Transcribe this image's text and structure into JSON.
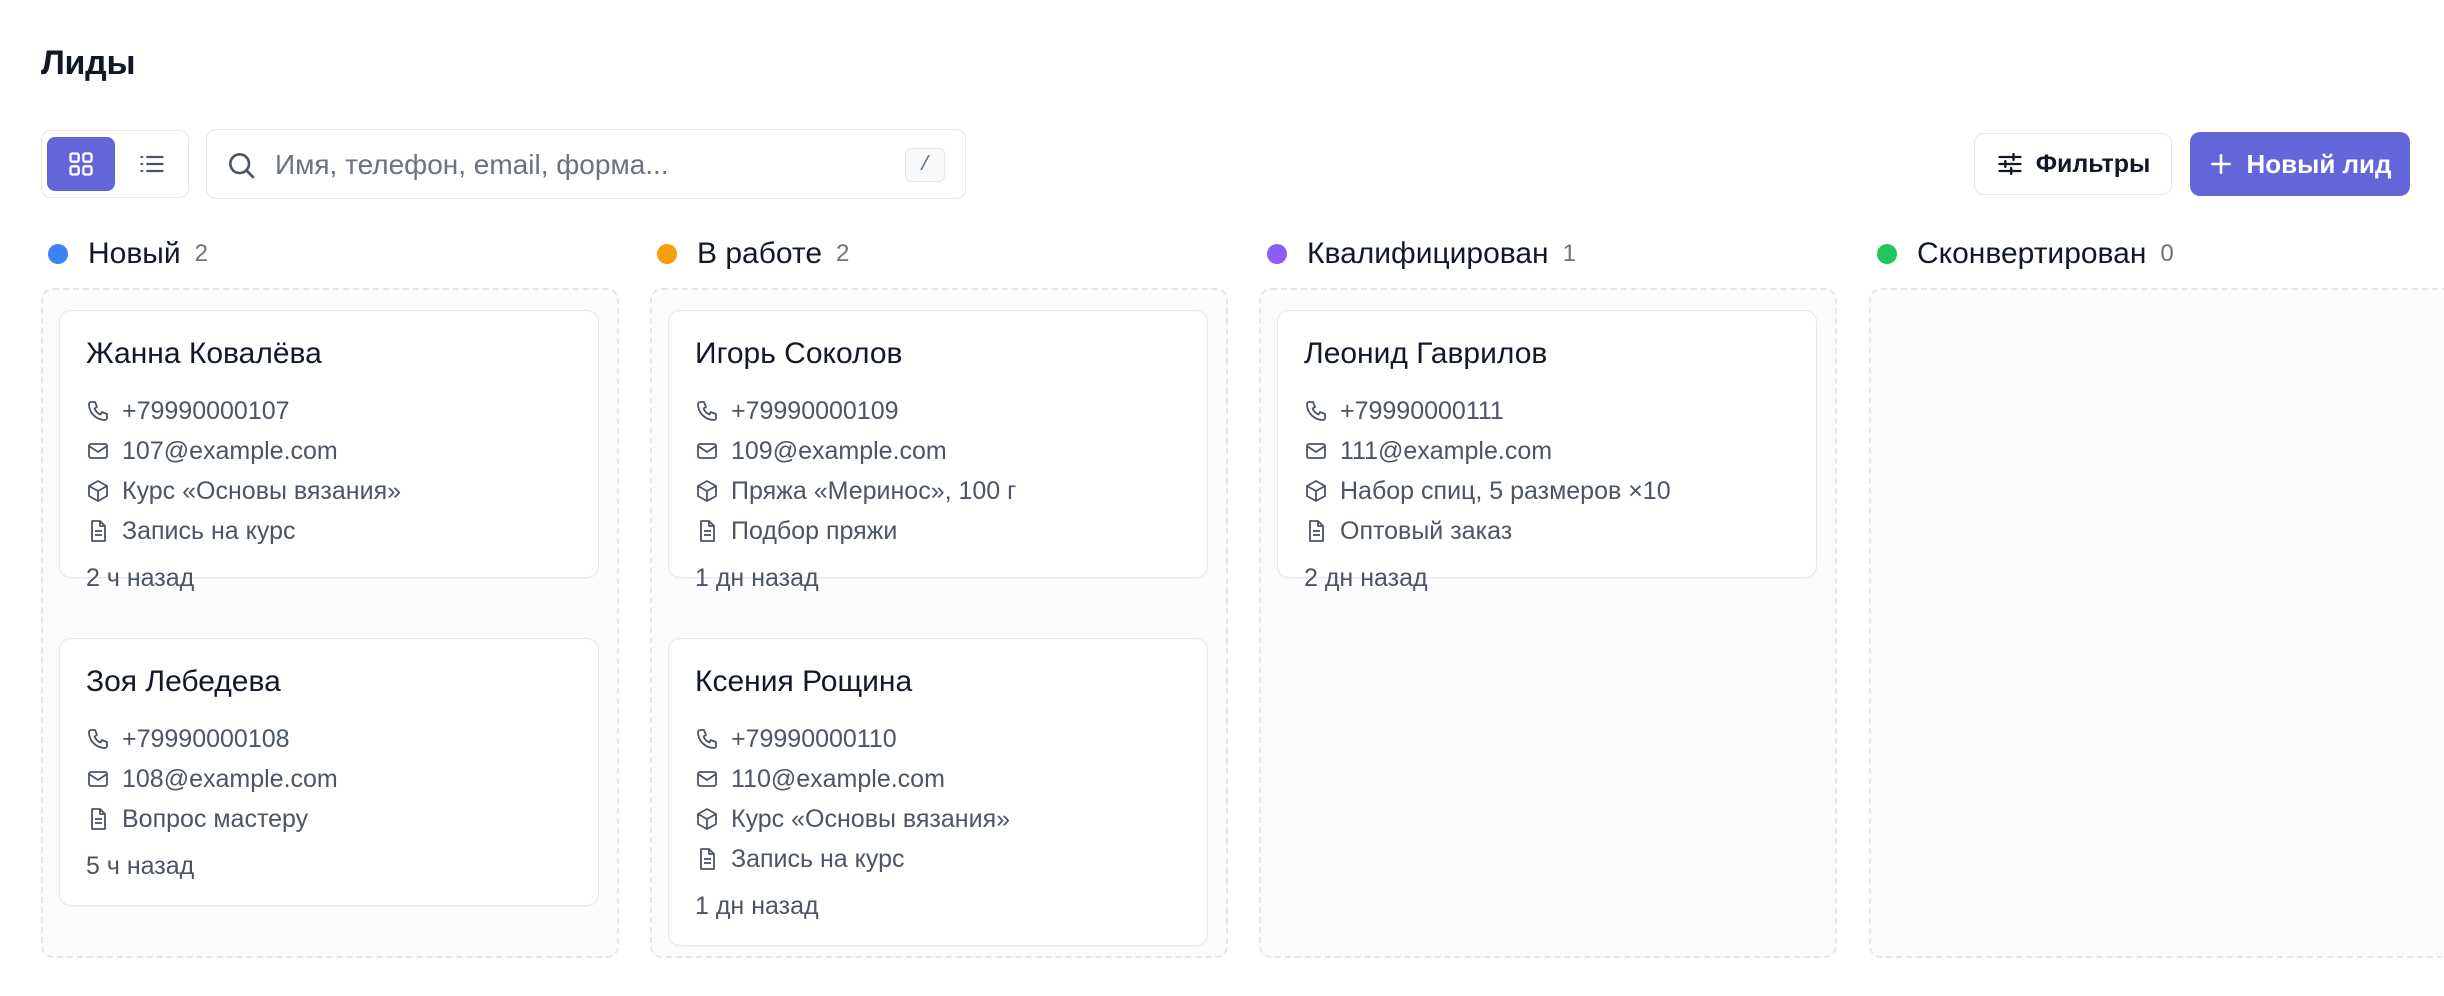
{
  "page": {
    "title": "Лиды"
  },
  "toolbar": {
    "view_modes": [
      "grid-icon",
      "list-icon"
    ],
    "active_view": "grid",
    "search": {
      "placeholder": "Имя, телефон, email, форма...",
      "value": "",
      "shortcut": "/"
    },
    "filters_label": "Фильтры",
    "new_lead_label": "Новый лид"
  },
  "colors": {
    "accent": "#6366d8",
    "new": "#3b82f6",
    "in_progress": "#f59e0b",
    "qualified": "#8b5cf6",
    "converted": "#22c55e"
  },
  "columns": [
    {
      "title": "Новый",
      "count": "2",
      "color": "#3b82f6",
      "cards": [
        {
          "name": "Жанна Ковалёва",
          "phone": "+79990000107",
          "email": "107@example.com",
          "product": "Курс «Основы вязания»",
          "form": "Запись на курс",
          "time": "2 ч назад"
        },
        {
          "name": "Зоя Лебедева",
          "phone": "+79990000108",
          "email": "108@example.com",
          "form": "Вопрос мастеру",
          "time": "5 ч назад"
        }
      ]
    },
    {
      "title": "В работе",
      "count": "2",
      "color": "#f59e0b",
      "cards": [
        {
          "name": "Игорь Соколов",
          "phone": "+79990000109",
          "email": "109@example.com",
          "product": "Пряжа «Меринос», 100 г",
          "form": "Подбор пряжи",
          "time": "1 дн назад"
        },
        {
          "name": "Ксения Рощина",
          "phone": "+79990000110",
          "email": "110@example.com",
          "product": "Курс «Основы вязания»",
          "form": "Запись на курс",
          "time": "1 дн назад"
        }
      ]
    },
    {
      "title": "Квалифицирован",
      "count": "1",
      "color": "#8b5cf6",
      "cards": [
        {
          "name": "Леонид Гаврилов",
          "phone": "+79990000111",
          "email": "111@example.com",
          "product": "Набор спиц, 5 размеров ×10",
          "form": "Оптовый заказ",
          "time": "2 дн назад"
        }
      ]
    },
    {
      "title": "Сконвертирован",
      "count": "0",
      "color": "#22c55e",
      "cards": []
    }
  ]
}
